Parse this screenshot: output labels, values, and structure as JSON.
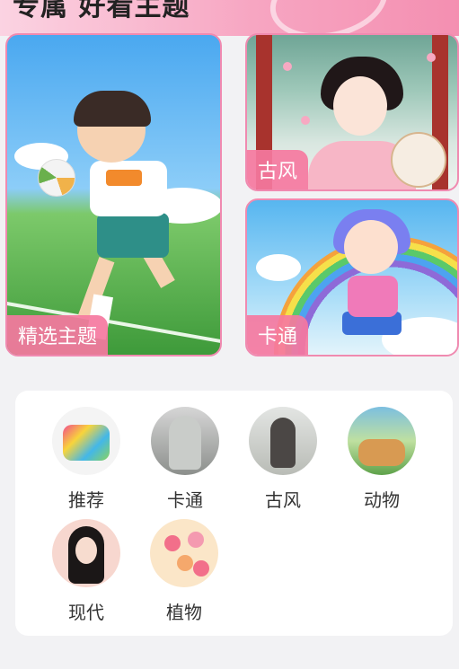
{
  "header": {
    "title": "专属 好看主题"
  },
  "featured": [
    {
      "tag": "精选主题"
    },
    {
      "tag": "古风"
    },
    {
      "tag": "卡通"
    }
  ],
  "categories": [
    {
      "label": "推荐"
    },
    {
      "label": "卡通"
    },
    {
      "label": "古风"
    },
    {
      "label": "动物"
    },
    {
      "label": "现代"
    },
    {
      "label": "植物"
    }
  ],
  "colors": {
    "accent": "#f08ab0",
    "tag_bg": "#f578a0",
    "panel_bg": "#ffffff",
    "page_bg": "#f2f2f4"
  }
}
